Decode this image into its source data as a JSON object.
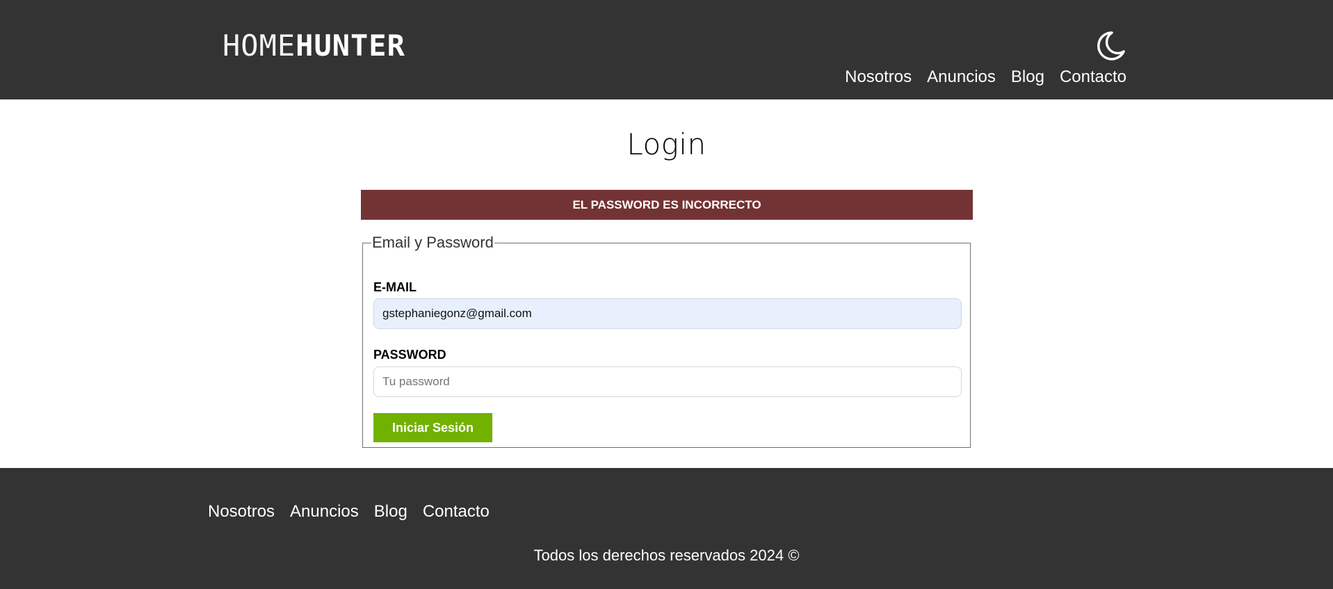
{
  "header": {
    "logo_part1": "HOME",
    "logo_part2": "HUNTER",
    "theme_toggle_icon": "moon-icon",
    "nav": [
      "Nosotros",
      "Anuncios",
      "Blog",
      "Contacto"
    ]
  },
  "main": {
    "title": "Login",
    "alert": "El Password es Incorrecto",
    "form": {
      "legend": "Email y Password",
      "email_label": "E-MAIL",
      "email_value": "gstephaniegonz@gmail.com",
      "password_label": "PASSWORD",
      "password_placeholder": "Tu password",
      "password_value": "",
      "submit_label": "Iniciar Sesión"
    }
  },
  "footer": {
    "nav": [
      "Nosotros",
      "Anuncios",
      "Blog",
      "Contacto"
    ],
    "copyright": "Todos los derechos reservados 2024 ©"
  },
  "colors": {
    "header_bg": "#333333",
    "alert_bg": "#733334",
    "button_bg": "#71b100",
    "autofill_bg": "#e8f0fe"
  }
}
